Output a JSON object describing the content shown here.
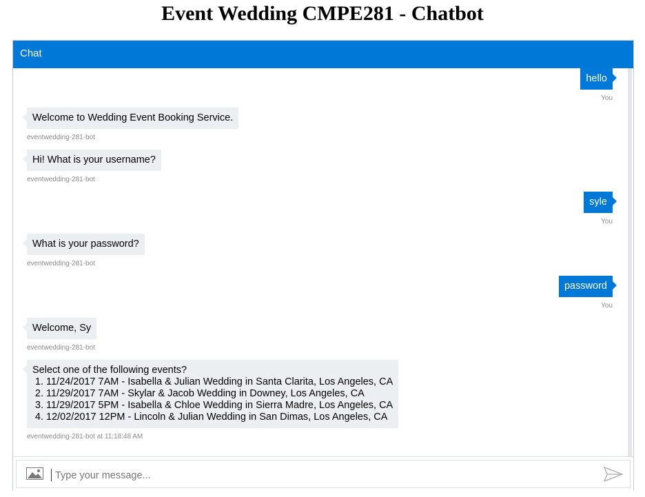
{
  "page": {
    "title": "Event Wedding CMPE281 - Chatbot"
  },
  "chat": {
    "header": "Chat"
  },
  "messages": [
    {
      "from": "user",
      "text": "hello",
      "meta": "You"
    },
    {
      "from": "bot",
      "text": "Welcome to Wedding Event Booking Service.",
      "meta": "eventwedding-281-bot"
    },
    {
      "from": "bot",
      "text": "Hi! What is your username?",
      "meta": "eventwedding-281-bot"
    },
    {
      "from": "user",
      "text": "syle",
      "meta": "You"
    },
    {
      "from": "bot",
      "text": "What is your password?",
      "meta": "eventwedding-281-bot"
    },
    {
      "from": "user",
      "text": "password",
      "meta": "You"
    },
    {
      "from": "bot",
      "text": "Welcome, Sy",
      "meta": "eventwedding-281-bot"
    },
    {
      "from": "bot",
      "text": "Select one of the following events?",
      "items": [
        "11/24/2017 7AM - Isabella & Julian Wedding in Santa Clarita, Los Angeles, CA",
        "11/29/2017 7AM - Skylar & Jacob Wedding in Downey, Los Angeles, CA",
        "11/29/2017 5PM - Isabella & Chloe Wedding in Sierra Madre, Los Angeles, CA",
        "12/02/2017 12PM - Lincoln & Julian Wedding in San Dimas, Los Angeles, CA"
      ],
      "meta": "eventwedding-281-bot at 11:18:48 AM"
    }
  ],
  "composer": {
    "placeholder": "Type your message...",
    "upload_icon": "image-icon",
    "send_icon": "send-icon"
  },
  "colors": {
    "accent": "#0078d7",
    "bot_bubble": "#eceff1",
    "meta_text": "#8a8a8a"
  }
}
